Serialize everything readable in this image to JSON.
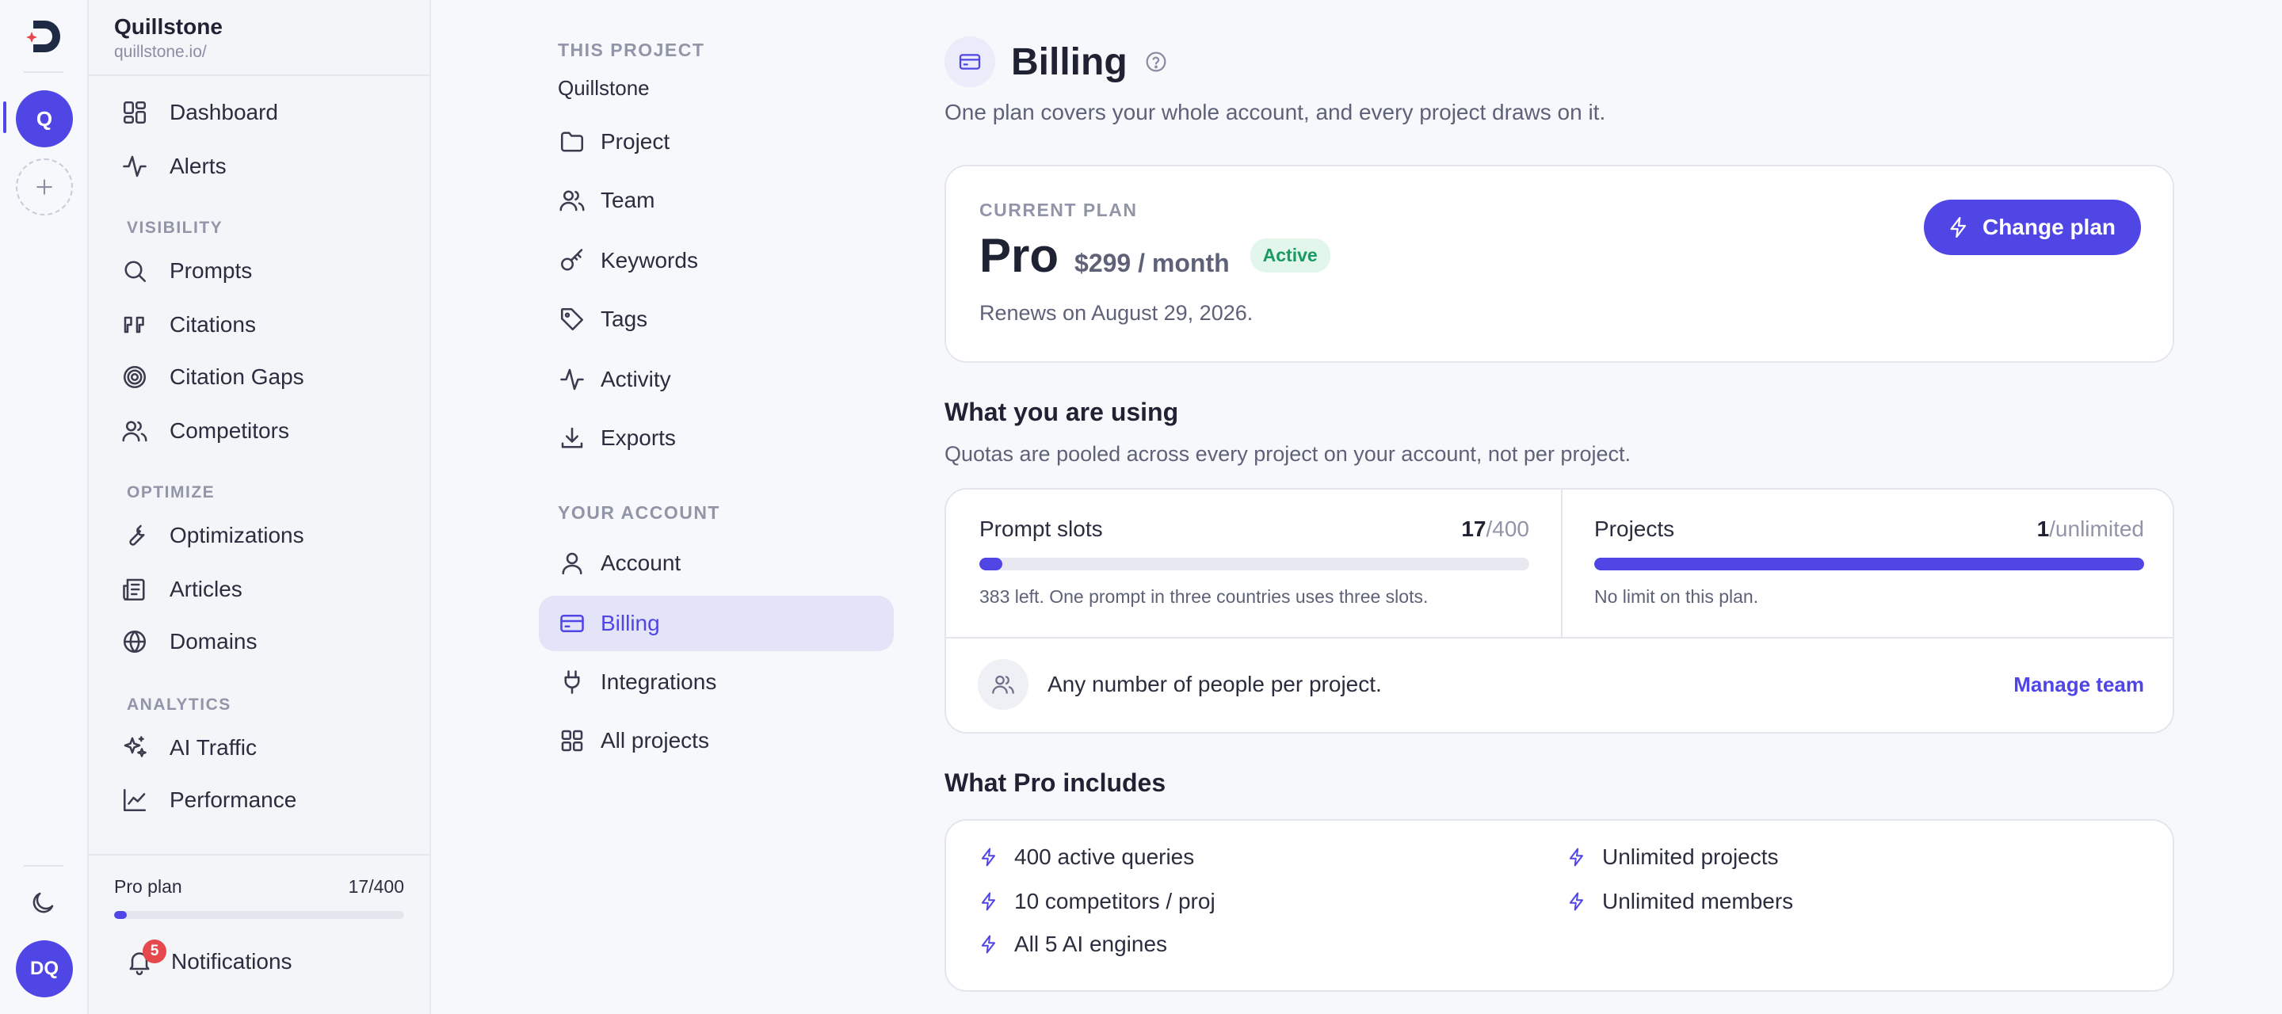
{
  "rail": {
    "workspace_initial": "Q",
    "user_initials": "DQ"
  },
  "sidebar": {
    "workspace_name": "Quillstone",
    "workspace_url": "quillstone.io/",
    "items": [
      {
        "label": "Dashboard",
        "icon": "dashboard-icon"
      },
      {
        "label": "Alerts",
        "icon": "activity-icon"
      }
    ],
    "sections": [
      {
        "title": "VISIBILITY",
        "items": [
          {
            "label": "Prompts",
            "icon": "search-icon"
          },
          {
            "label": "Citations",
            "icon": "quote-icon"
          },
          {
            "label": "Citation Gaps",
            "icon": "target-icon"
          },
          {
            "label": "Competitors",
            "icon": "users-icon"
          }
        ]
      },
      {
        "title": "OPTIMIZE",
        "items": [
          {
            "label": "Optimizations",
            "icon": "wrench-icon"
          },
          {
            "label": "Articles",
            "icon": "newspaper-icon"
          },
          {
            "label": "Domains",
            "icon": "globe-icon"
          }
        ]
      },
      {
        "title": "ANALYTICS",
        "items": [
          {
            "label": "AI Traffic",
            "icon": "sparkles-icon"
          },
          {
            "label": "Performance",
            "icon": "line-chart-icon"
          }
        ]
      }
    ],
    "plan": {
      "label": "Pro plan",
      "used": "17",
      "total": "400",
      "usage_text": "17/400",
      "fraction": 0.0425
    },
    "notifications": {
      "label": "Notifications",
      "count": "5"
    }
  },
  "settings_nav": {
    "project_section": "THIS PROJECT",
    "project_name": "Quillstone",
    "project_items": [
      {
        "label": "Project",
        "icon": "folder-icon"
      },
      {
        "label": "Team",
        "icon": "users-icon"
      },
      {
        "label": "Keywords",
        "icon": "key-icon"
      },
      {
        "label": "Tags",
        "icon": "tag-icon"
      },
      {
        "label": "Activity",
        "icon": "activity-icon"
      },
      {
        "label": "Exports",
        "icon": "download-icon"
      }
    ],
    "account_section": "YOUR ACCOUNT",
    "account_items": [
      {
        "label": "Account",
        "icon": "user-icon"
      },
      {
        "label": "Billing",
        "icon": "credit-card-icon",
        "active": true
      },
      {
        "label": "Integrations",
        "icon": "plug-icon"
      },
      {
        "label": "All projects",
        "icon": "grid-icon"
      }
    ]
  },
  "billing": {
    "title": "Billing",
    "subtitle": "One plan covers your whole account, and every project draws on it.",
    "current_plan": {
      "label": "CURRENT PLAN",
      "name": "Pro",
      "price": "$299 / month",
      "status": "Active",
      "renews": "Renews on August 29, 2026.",
      "change_button": "Change plan"
    },
    "usage": {
      "title": "What you are using",
      "subtitle": "Quotas are pooled across every project on your account, not per project.",
      "prompt_slots": {
        "label": "Prompt slots",
        "used": "17",
        "limit": "/400",
        "fraction": 0.0425,
        "note": "383 left. One prompt in three countries uses three slots."
      },
      "projects": {
        "label": "Projects",
        "used": "1",
        "limit": "/unlimited",
        "fraction": 1.0,
        "note": "No limit on this plan."
      },
      "team": {
        "text": "Any number of people per project.",
        "link": "Manage team"
      }
    },
    "includes": {
      "title": "What Pro includes",
      "items": [
        "400 active queries",
        "Unlimited projects",
        "10 competitors / proj",
        "Unlimited members",
        "All 5 AI engines"
      ]
    }
  },
  "colors": {
    "accent": "#4f46e5",
    "active_badge": "#1a9a63",
    "notif_badge": "#e5484d"
  }
}
